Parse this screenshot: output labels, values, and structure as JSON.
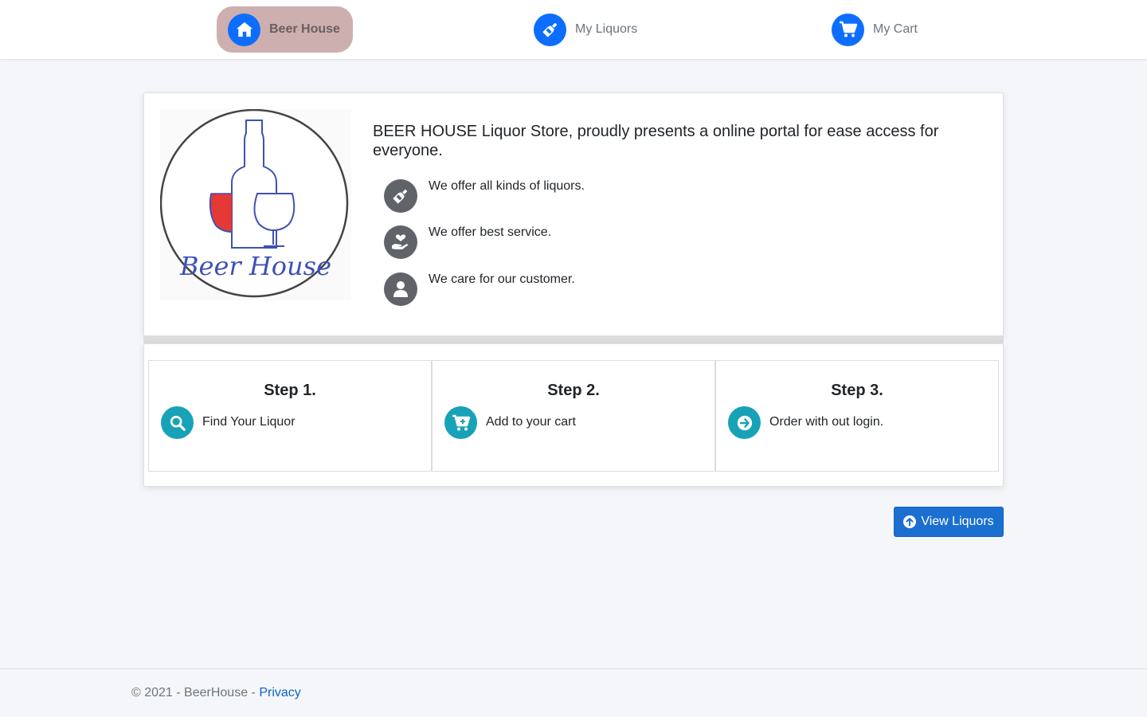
{
  "nav": {
    "items": [
      {
        "label": "Beer House",
        "icon": "home-icon",
        "active": true
      },
      {
        "label": "My Liquors",
        "icon": "bottle-icon",
        "active": false
      },
      {
        "label": "My Cart",
        "icon": "cart-icon",
        "active": false
      }
    ]
  },
  "intro": {
    "logo_text": "Beer House",
    "headline": "BEER HOUSE Liquor Store, proudly presents a online portal for ease access for everyone.",
    "features": [
      {
        "text": "We offer all kinds of liquors.",
        "icon": "bottle-icon"
      },
      {
        "text": "We offer best service.",
        "icon": "hand-heart-icon"
      },
      {
        "text": "We care for our customer.",
        "icon": "user-icon"
      }
    ]
  },
  "steps": [
    {
      "title": "Step 1.",
      "text": "Find Your Liquor",
      "icon": "search-icon"
    },
    {
      "title": "Step 2.",
      "text": "Add to your cart",
      "icon": "cart-plus-icon"
    },
    {
      "title": "Step 3.",
      "text": "Order with out login.",
      "icon": "arrow-right-circle-icon"
    }
  ],
  "view_button": {
    "label": "View Liquors",
    "icon": "arrow-up-circle-icon"
  },
  "footer": {
    "copyright": "© 2021 - BeerHouse - ",
    "privacy_link": "Privacy"
  },
  "colors": {
    "nav_icon_bg": "#0d6efd",
    "nav_active_bg": "#cdafaf",
    "feature_icon_bg": "#60646a",
    "step_icon_bg": "#17a2b8",
    "button_bg": "#1a6fd1",
    "wine_red": "#e53935",
    "logo_blue": "#3f51b5"
  }
}
